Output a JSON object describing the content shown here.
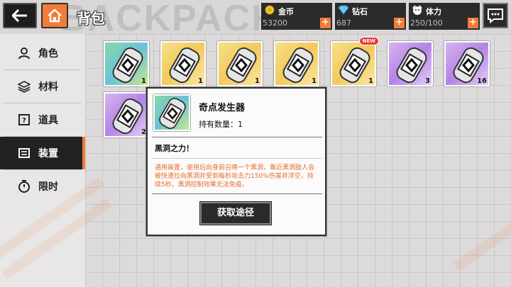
{
  "header": {
    "title": "背包",
    "bg_title": "BACKPACK"
  },
  "resources": [
    {
      "label": "金币",
      "value": "53200",
      "icon": "gold-coin-icon"
    },
    {
      "label": "钻石",
      "value": "687",
      "icon": "diamond-icon"
    },
    {
      "label": "体力",
      "value": "250/100",
      "icon": "stamina-icon"
    }
  ],
  "sidebar": {
    "items": [
      {
        "label": "角色",
        "icon": "person-icon"
      },
      {
        "label": "材料",
        "icon": "layers-icon"
      },
      {
        "label": "道具",
        "icon": "prop-card-icon"
      },
      {
        "label": "装置",
        "icon": "device-icon",
        "active": true
      },
      {
        "label": "限时",
        "icon": "timer-icon"
      }
    ]
  },
  "items": [
    {
      "count": "1",
      "rarity": "green"
    },
    {
      "count": "1",
      "rarity": "gold"
    },
    {
      "count": "1",
      "rarity": "gold"
    },
    {
      "count": "1",
      "rarity": "gold"
    },
    {
      "count": "1",
      "rarity": "gold",
      "badge": "NEW"
    },
    {
      "count": "3",
      "rarity": "purple"
    },
    {
      "count": "16",
      "rarity": "purple"
    },
    {
      "count": "2",
      "rarity": "purple"
    }
  ],
  "popup": {
    "name": "奇点发生器",
    "quantity": "持有数量：1",
    "subtitle": "黑洞之力！",
    "description": "通用装置，使用后向身前召唤一个黑洞，靠近黑洞敌人会被快速拉向黑洞并受到每秒攻击力150%伤害并浮空，持续5秒。黑洞控制效果无法免疫。",
    "button": "获取途径"
  },
  "colors": {
    "accent": "#f27b3a",
    "dark": "#2b2b2b"
  }
}
